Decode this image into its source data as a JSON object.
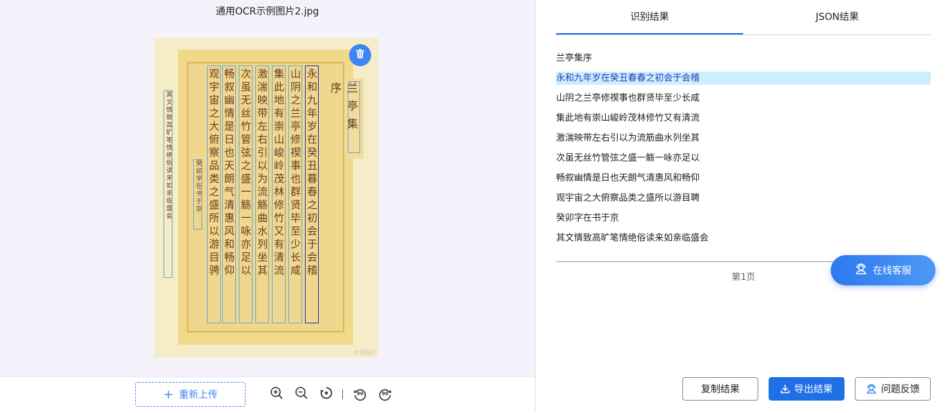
{
  "file": {
    "name": "通用OCR示例图片2.jpg"
  },
  "image": {
    "title_chars": "兰亭集序",
    "columns": [
      "永和九年岁在癸丑暮春之初会于会稽",
      "山阴之兰亭修禊事也群贤毕至少长咸",
      "集此地有崇山峻岭茂林修竹又有清流",
      "激湍映带左右引以为流觞曲水列坐其",
      "次虽无丝竹管弦之盛一觞一咏亦足以",
      "畅叙幽情是日也天朗气清惠风和畅仰",
      "观宇宙之大俯察品类之盛所以游目骋"
    ],
    "sign_col": "癸卯字在书于京",
    "note_col": "其文情致高旷笔情绝俗读来如亲临盛会",
    "watermark": "大师图片"
  },
  "toolbar": {
    "reupload_label": "重新上传",
    "rotate_left_label": "90",
    "rotate_right_label": "90"
  },
  "tabs": [
    {
      "label": "识别结果",
      "active": true
    },
    {
      "label": "JSON结果",
      "active": false
    }
  ],
  "results": [
    {
      "text": "兰亭集序",
      "highlighted": false
    },
    {
      "text": "永和九年岁在癸丑春春之初会于会稽",
      "highlighted": true
    },
    {
      "text": "山阴之兰亭修禊事也群贤毕至少长咸",
      "highlighted": false
    },
    {
      "text": "集此地有崇山峻岭茂林修竹又有清流",
      "highlighted": false
    },
    {
      "text": "激湍映带左右引以为流筋曲水列坐其",
      "highlighted": false
    },
    {
      "text": "次虽无丝竹管弦之盛一觞一咏亦足以",
      "highlighted": false
    },
    {
      "text": "畅叙幽情是日也天朗气清惠风和畅仰",
      "highlighted": false
    },
    {
      "text": "观宇宙之大俯察品类之盛所以游目聘",
      "highlighted": false
    },
    {
      "text": "癸卯字在书于京",
      "highlighted": false
    },
    {
      "text": "其文情致高旷笔情绝俗读来如亲临盛会",
      "highlighted": false
    }
  ],
  "page_label": "第1页",
  "service_label": "在线客服",
  "actions": {
    "copy_label": "复制结果",
    "export_label": "导出结果",
    "feedback_label": "问题反馈"
  },
  "colors": {
    "accent": "#1f6fe5",
    "highlight_bg": "#cdeefe",
    "left_panel_bg": "#f4f3fc"
  },
  "icons": {
    "delete": "trash-icon",
    "zoom_in": "zoom-in-icon",
    "zoom_out": "zoom-out-icon",
    "reset": "rotate-reset-icon",
    "rotate_left": "rotate-left-90-icon",
    "rotate_right": "rotate-right-90-icon",
    "service": "headset-icon",
    "export": "download-icon",
    "feedback": "headset-icon"
  }
}
